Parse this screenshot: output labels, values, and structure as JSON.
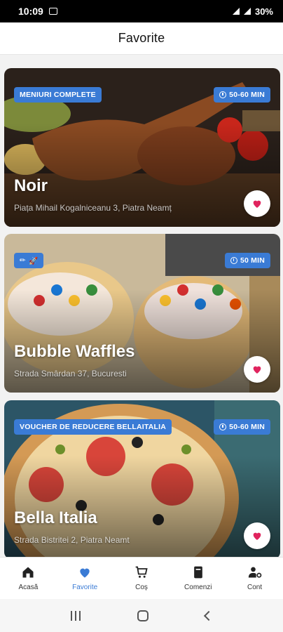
{
  "status_bar": {
    "time": "10:09",
    "battery": "30%"
  },
  "header": {
    "title": "Favorite"
  },
  "cards": [
    {
      "name": "Noir",
      "address": "Piața Mihail Kogalniceanu 3, Piatra Neamț",
      "badge": "MENIURI COMPLETE",
      "time": "50-60 MIN",
      "favorited": true
    },
    {
      "name": "Bubble Waffles",
      "address": "Strada Smârdan 37, Bucuresti",
      "badge": "",
      "badge_icons": [
        "pen-icon",
        "rocket-icon"
      ],
      "time": "50 MIN",
      "favorited": true
    },
    {
      "name": "Bella Italia",
      "address": "Strada Bistritei 2, Piatra Neamt",
      "badge": "VOUCHER DE REDUCERE BELLAITALIA",
      "time": "50-60 MIN",
      "favorited": true
    }
  ],
  "bottom_nav": [
    {
      "label": "Acasă",
      "icon": "home-icon",
      "active": false
    },
    {
      "label": "Favorite",
      "icon": "heart-icon",
      "active": true
    },
    {
      "label": "Coș",
      "icon": "cart-icon",
      "active": false
    },
    {
      "label": "Comenzi",
      "icon": "book-icon",
      "active": false
    },
    {
      "label": "Cont",
      "icon": "user-settings-icon",
      "active": false
    }
  ],
  "colors": {
    "accent": "#3a7bd5",
    "heart": "#e0245e"
  }
}
